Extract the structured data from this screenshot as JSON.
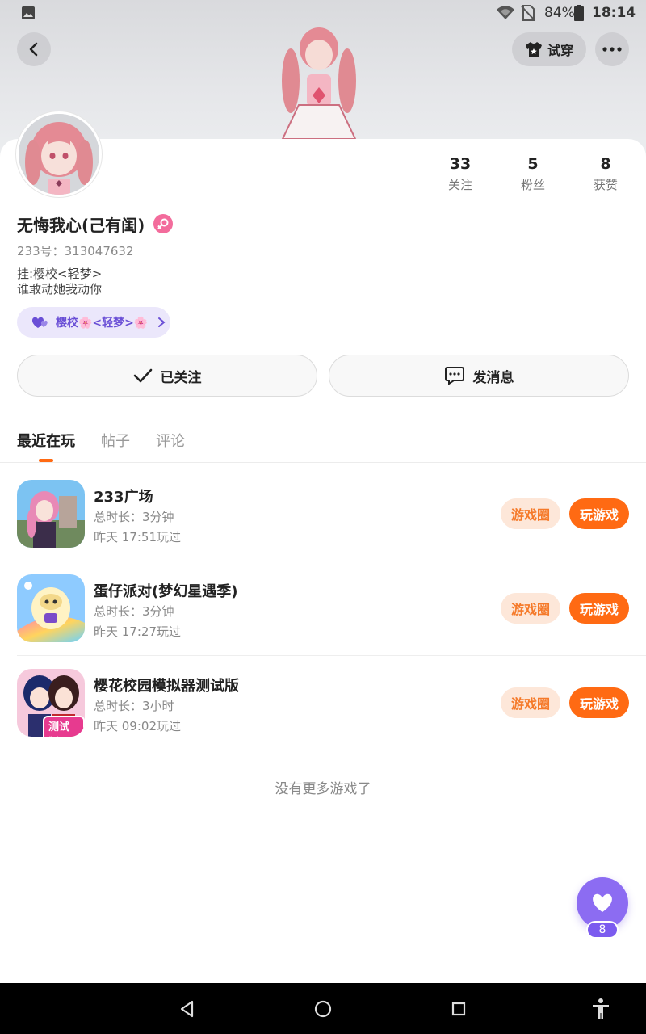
{
  "status_bar": {
    "battery": "84%",
    "time": "18:14",
    "icons": [
      "image-icon",
      "wifi-icon",
      "no-sim-icon",
      "battery-icon"
    ]
  },
  "header": {
    "try_on_label": "试穿",
    "icons": [
      "back-arrow-icon",
      "shirt-icon",
      "more-icon"
    ]
  },
  "profile": {
    "stats": [
      {
        "value": "33",
        "label": "关注"
      },
      {
        "value": "5",
        "label": "粉丝"
      },
      {
        "value": "8",
        "label": "获赞"
      }
    ],
    "name": "无悔我心(己有闺)",
    "gender_icon": "female-symbol-icon",
    "uid": "233号：313047632",
    "bio_lines": [
      "挂:樱校<轻梦>",
      "谁敢动她我动你"
    ],
    "club_tag": "樱校🌸<轻梦>🌸"
  },
  "actions": {
    "follow_label": "已关注",
    "message_label": "发消息"
  },
  "tabs": [
    {
      "label": "最近在玩",
      "active": true
    },
    {
      "label": "帖子",
      "active": false
    },
    {
      "label": "评论",
      "active": false
    }
  ],
  "games": [
    {
      "title": "233广场",
      "duration": "总时长：3分钟",
      "last_played": "昨天 17:51玩过",
      "circle_label": "游戏圈",
      "play_label": "玩游戏"
    },
    {
      "title": "蛋仔派对(梦幻星遇季)",
      "duration": "总时长：3分钟",
      "last_played": "昨天 17:27玩过",
      "circle_label": "游戏圈",
      "play_label": "玩游戏"
    },
    {
      "title": "樱花校园模拟器测试版",
      "duration": "总时长：3小时",
      "last_played": "昨天 09:02玩过",
      "circle_label": "游戏圈",
      "play_label": "玩游戏",
      "icon_badge": "测试版"
    }
  ],
  "empty_text": "没有更多游戏了",
  "like_button": {
    "count": "8"
  },
  "colors": {
    "accent": "#ff6a13",
    "accent_light": "#fde7d9",
    "purple": "#8c6cf2",
    "pink": "#f36c9c"
  }
}
